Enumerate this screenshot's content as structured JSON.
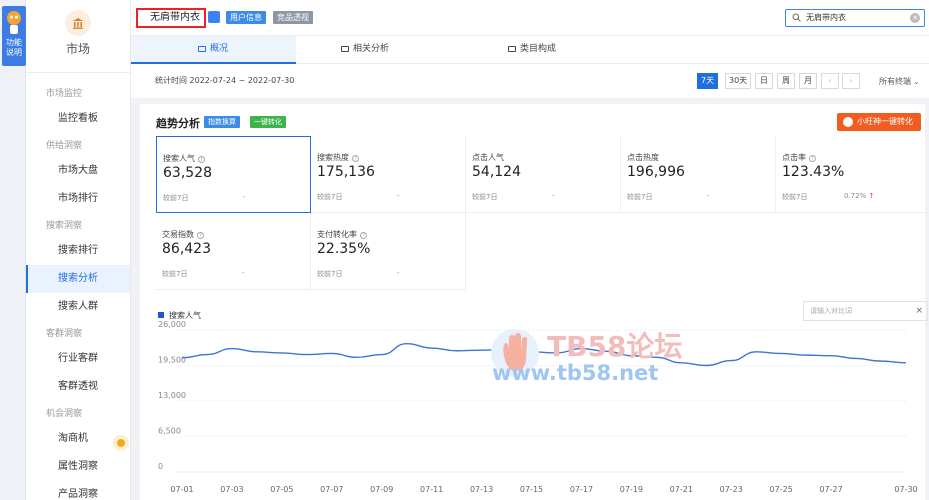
{
  "help": {
    "label_1": "功能",
    "label_2": "说明"
  },
  "sidebar": {
    "brand": "市场",
    "sections": [
      {
        "title": "市场监控",
        "items": [
          "监控看板"
        ]
      },
      {
        "title": "供给洞察",
        "items": [
          "市场大盘",
          "市场排行"
        ]
      },
      {
        "title": "搜索洞察",
        "items": [
          "搜索排行",
          "搜索分析",
          "搜索人群"
        ]
      },
      {
        "title": "客群洞察",
        "items": [
          "行业客群",
          "客群透视"
        ]
      },
      {
        "title": "机会洞察",
        "items": [
          "淘商机",
          "属性洞察",
          "产品洞察"
        ]
      }
    ],
    "active_item": "搜索分析"
  },
  "header": {
    "keyword": "无肩带内衣",
    "tag_user": "用户信息",
    "tag_compare": "竞品透视",
    "search_value": "无肩带内衣"
  },
  "tabs": [
    "概况",
    "相关分析",
    "类目构成"
  ],
  "time": {
    "stat_text": "统计时间 2022-07-24 ~ 2022-07-30",
    "ranges": [
      "7天",
      "30天",
      "日",
      "周",
      "月"
    ],
    "active_range": "7天",
    "prev": "‹",
    "next": "›",
    "terminal": "所有终端"
  },
  "trend": {
    "title": "趋势分析",
    "tag_index": "指数换算",
    "tag_convert": "一键转化",
    "orange_button": "小旺神一键转化"
  },
  "metrics": [
    {
      "label": "搜索人气",
      "value": "63,528",
      "compare_label": "较前7日",
      "compare_value": "-"
    },
    {
      "label": "搜索热度",
      "value": "175,136",
      "compare_label": "较前7日",
      "compare_value": "-"
    },
    {
      "label": "点击人气",
      "value": "54,124",
      "compare_label": "较前7日",
      "compare_value": "-"
    },
    {
      "label": "点击热度",
      "value": "196,996",
      "compare_label": "较前7日",
      "compare_value": "-"
    },
    {
      "label": "点击率",
      "value": "123.43%",
      "compare_label": "较前7日",
      "compare_value": "0.72%",
      "up_arrow": "↑"
    },
    {
      "label": "交易指数",
      "value": "86,423",
      "compare_label": "较前7日",
      "compare_value": "-"
    },
    {
      "label": "支付转化率",
      "value": "22.35%",
      "compare_label": "较前7日",
      "compare_value": "-"
    }
  ],
  "compare_input": {
    "placeholder": "请输入对比词",
    "close": "×"
  },
  "watermark": {
    "text_1": "TB58论坛",
    "text_2": "www.tb58.net"
  },
  "colors": {
    "accent": "#1f6fe0",
    "line": "#3f74d6",
    "orange": "#f25c1f"
  },
  "chart_data": {
    "type": "line",
    "legend": "搜索人气",
    "categories": [
      "07-01",
      "07-02",
      "07-03",
      "07-04",
      "07-05",
      "07-06",
      "07-07",
      "07-08",
      "07-09",
      "07-10",
      "07-11",
      "07-12",
      "07-13",
      "07-14",
      "07-15",
      "07-16",
      "07-17",
      "07-18",
      "07-19",
      "07-20",
      "07-21",
      "07-22",
      "07-23",
      "07-24",
      "07-25",
      "07-26",
      "07-27",
      "07-28",
      "07-29",
      "07-30"
    ],
    "tick_labels": [
      "07-01",
      "07-03",
      "07-05",
      "07-07",
      "07-09",
      "07-11",
      "07-13",
      "07-15",
      "07-17",
      "07-19",
      "07-21",
      "07-23",
      "07-25",
      "07-27",
      "07-30"
    ],
    "values": [
      20900,
      21500,
      22600,
      22000,
      21800,
      21500,
      21700,
      21000,
      21500,
      23500,
      22700,
      22200,
      22300,
      22500,
      22000,
      21800,
      22600,
      22100,
      21300,
      21000,
      20000,
      19500,
      20400,
      22000,
      21700,
      21400,
      21300,
      20800,
      20300,
      20000
    ],
    "y_ticks": [
      "0",
      "6,500",
      "13,000",
      "19,500",
      "26,000"
    ],
    "ylim": [
      0,
      26000
    ]
  }
}
